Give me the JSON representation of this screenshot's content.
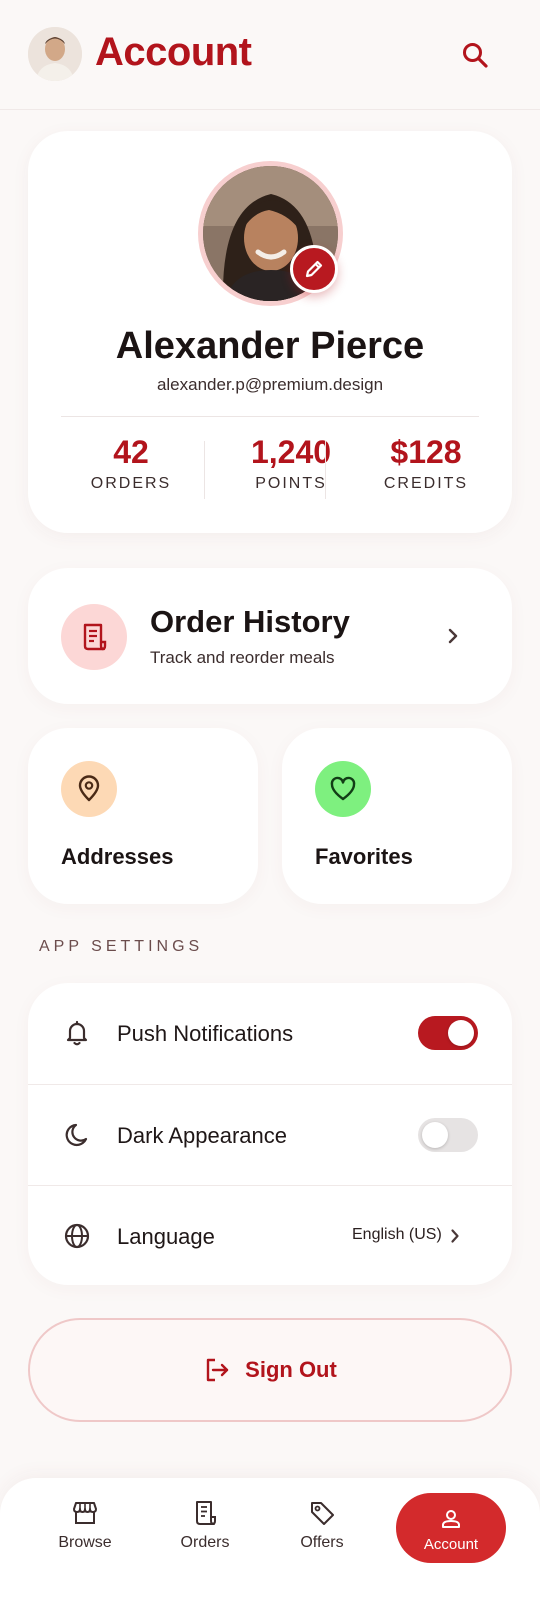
{
  "header": {
    "title": "Account",
    "avatar_icon": "user-avatar",
    "search_icon": "search-icon"
  },
  "profile": {
    "name": "Alexander Pierce",
    "email": "alexander.p@premium.design",
    "edit_icon": "pencil-icon",
    "stats": [
      {
        "value": "42",
        "label": "ORDERS"
      },
      {
        "value": "1,240",
        "label": "POINTS"
      },
      {
        "value": "$128",
        "label": "CREDITS"
      }
    ]
  },
  "order_history": {
    "title": "Order History",
    "subtitle": "Track and reorder meals",
    "icon": "receipt-icon"
  },
  "tiles": [
    {
      "label": "Addresses",
      "icon": "location-pin-icon",
      "color": "#fdd9b5"
    },
    {
      "label": "Favorites",
      "icon": "heart-icon",
      "color": "#7ef07f"
    }
  ],
  "settings": {
    "section_label": "APP SETTINGS",
    "items": [
      {
        "label": "Push Notifications",
        "icon": "bell-icon",
        "toggle": true
      },
      {
        "label": "Dark Appearance",
        "icon": "moon-icon",
        "toggle": false
      },
      {
        "label": "Language",
        "icon": "globe-icon",
        "value": "English (US)"
      }
    ]
  },
  "sign_out": {
    "label": "Sign Out",
    "icon": "logout-icon"
  },
  "bottom_nav": {
    "items": [
      {
        "label": "Browse",
        "icon": "storefront-icon"
      },
      {
        "label": "Orders",
        "icon": "receipt-icon"
      },
      {
        "label": "Offers",
        "icon": "tag-icon"
      },
      {
        "label": "Account",
        "icon": "person-icon",
        "active": true
      }
    ]
  },
  "colors": {
    "accent": "#b2141c",
    "accent_bright": "#d32a2c",
    "background": "#fbf8f7",
    "toggle_on": "#b81920",
    "toggle_off": "#e6e3e3"
  }
}
